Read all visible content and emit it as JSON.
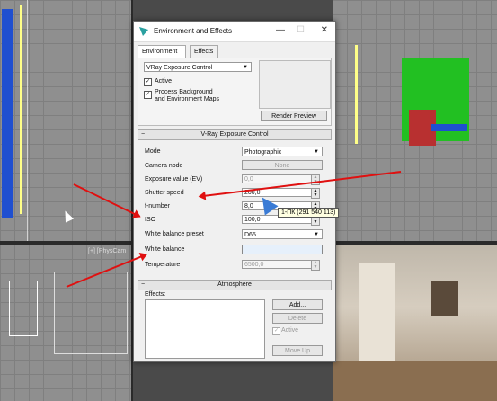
{
  "window": {
    "title": "Environment and Effects",
    "tabs": [
      "Environment",
      "Effects"
    ]
  },
  "exposure_top": {
    "dropdown_value": "VRay Exposure Control",
    "active_label": "Active",
    "process_bg_label_1": "Process Background",
    "process_bg_label_2": "and Environment Maps",
    "render_preview": "Render Preview"
  },
  "vray_exposure": {
    "header": "V-Ray Exposure Control",
    "mode_label": "Mode",
    "mode_value": "Photographic",
    "camera_node_label": "Camera node",
    "camera_node_button": "None",
    "exposure_value_label": "Exposure value (EV)",
    "exposure_value": "0,0",
    "shutter_speed_label": "Shutter speed",
    "shutter_speed_value": "200,0",
    "fnumber_label": "f-number",
    "fnumber_value": "8,0",
    "iso_label": "ISO",
    "iso_value": "100,0",
    "wb_preset_label": "White balance preset",
    "wb_preset_value": "D65",
    "white_balance_label": "White balance",
    "white_balance_color": "#e6f0fb",
    "temperature_label": "Temperature",
    "temperature_value": "6500,0"
  },
  "atmosphere": {
    "header": "Atmosphere",
    "effects_label": "Effects:",
    "add": "Add...",
    "delete": "Delete",
    "active": "Active",
    "move_up": "Move Up"
  },
  "tooltip": "1-ПК (291 540 113)",
  "viewport_label": "[+] [PhysCam",
  "colors": {
    "arrow": "#e01010",
    "green_object": "#22c022",
    "blue_object": "#1f4fd0"
  }
}
